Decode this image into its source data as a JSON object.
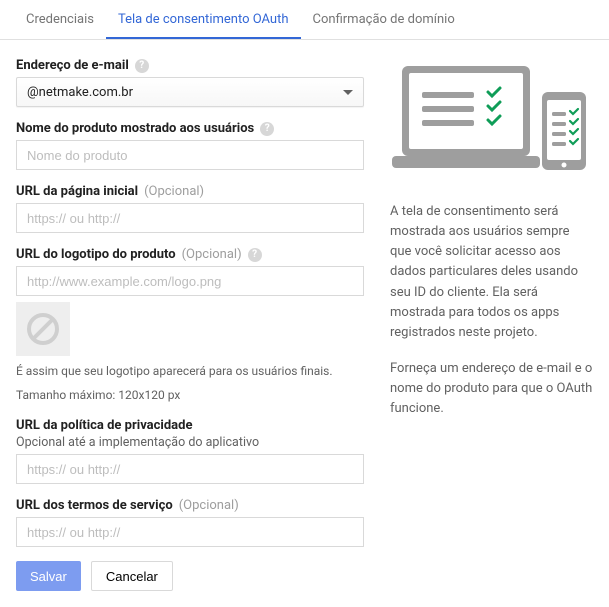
{
  "tabs": {
    "credentials": "Credenciais",
    "consent": "Tela de consentimento OAuth",
    "domain": "Confirmação de domínio"
  },
  "fields": {
    "email": {
      "label": "Endereço de e-mail",
      "value": "@netmake.com.br"
    },
    "productName": {
      "label": "Nome do produto mostrado aos usuários",
      "placeholder": "Nome do produto"
    },
    "homepage": {
      "label": "URL da página inicial",
      "optional": "(Opcional)",
      "placeholder": "https:// ou http://"
    },
    "logoUrl": {
      "label": "URL do logotipo do produto",
      "optional": "(Opcional)",
      "placeholder": "http://www.example.com/logo.png",
      "hint1": "É assim que seu logotipo aparecerá para os usuários finais.",
      "hint2": "Tamanho máximo: 120x120 px"
    },
    "privacy": {
      "label": "URL da política de privacidade",
      "sublabel": "Opcional até a implementação do aplicativo",
      "placeholder": "https:// ou http://"
    },
    "tos": {
      "label": "URL dos termos de serviço",
      "optional": "(Opcional)",
      "placeholder": "https:// ou http://"
    }
  },
  "buttons": {
    "save": "Salvar",
    "cancel": "Cancelar"
  },
  "info": {
    "p1": "A tela de consentimento será mostrada aos usuários sempre que você solicitar acesso aos dados particulares deles usando seu ID do cliente. Ela será mostrada para todos os apps registrados neste projeto.",
    "p2": "Forneça um endereço de e-mail e o nome do produto para que o OAuth funcione."
  }
}
